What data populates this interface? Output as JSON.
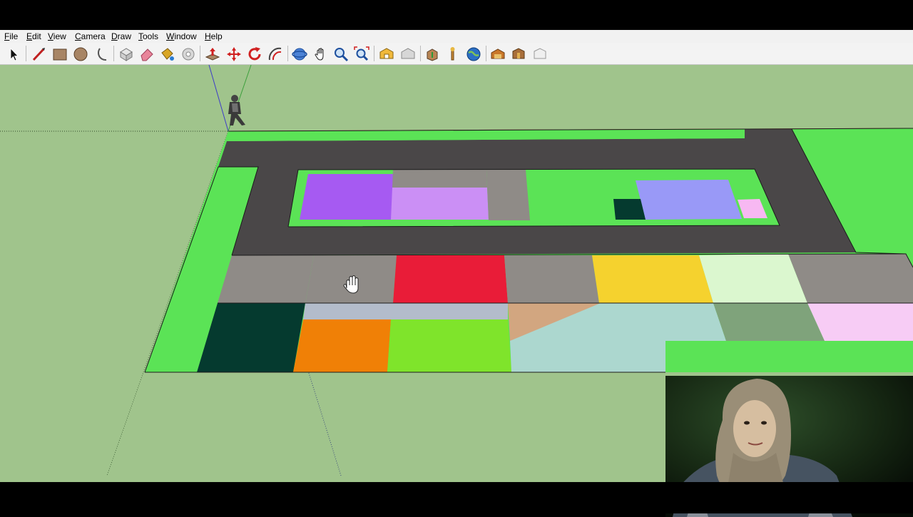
{
  "menu": {
    "file": {
      "mnemonic": "F",
      "rest": "ile"
    },
    "edit": {
      "mnemonic": "E",
      "rest": "dit"
    },
    "view": {
      "mnemonic": "V",
      "rest": "iew"
    },
    "camera": {
      "mnemonic": "C",
      "rest": "amera"
    },
    "draw": {
      "mnemonic": "D",
      "rest": "raw"
    },
    "tools": {
      "mnemonic": "T",
      "rest": "ools"
    },
    "window": {
      "mnemonic": "W",
      "rest": "indow"
    },
    "help": {
      "mnemonic": "H",
      "rest": "elp"
    }
  },
  "toolbar_icons": [
    "select-icon",
    "line-icon",
    "rectangle-icon",
    "circle-icon",
    "arc-icon",
    "make-component-icon",
    "eraser-icon",
    "paint-bucket-icon",
    "tape-measure-icon",
    "push-pull-icon",
    "move-icon",
    "rotate-icon",
    "offset-icon",
    "orbit-icon",
    "pan-icon",
    "zoom-icon",
    "zoom-extents-icon",
    "3d-warehouse-icon",
    "share-model-icon",
    "get-models-icon",
    "place-model-icon",
    "google-earth-icon",
    "extension-warehouse-icon",
    "extension-manager-icon",
    "send-to-layout-icon"
  ],
  "colors": {
    "ground": "#a0c48c",
    "grass": "#5be356",
    "road": "#4a4748",
    "purple": "#a65af2",
    "light_purple": "#cb8ff5",
    "concrete": "#8f8b87",
    "dark_green": "#053a2f",
    "periwinkle": "#9999f7",
    "pink": "#f7b8f2",
    "red": "#e91c38",
    "yellow": "#f5d22e",
    "pale_green": "#dbf7cf",
    "steel_blue": "#b3bccb",
    "tan": "#d2a680",
    "pale_aqua": "#acd7cf",
    "sage": "#7fa37b",
    "orange": "#f08006",
    "lime": "#7fe42b",
    "light_pink": "#f7ccf5",
    "red_axis": "#c83c3c",
    "green_axis": "#3ca03c",
    "blue_axis": "#3c3cc8"
  }
}
